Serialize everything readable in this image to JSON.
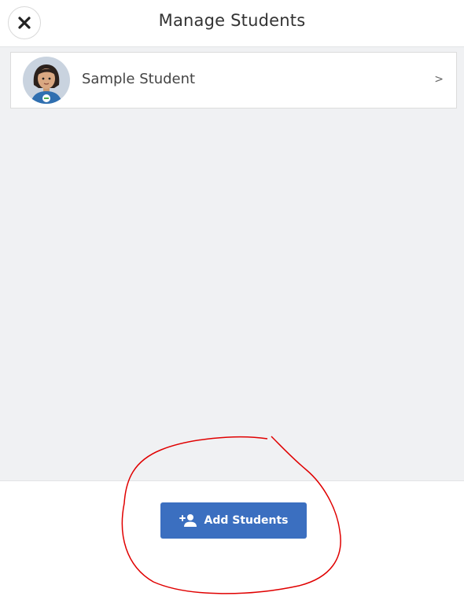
{
  "header": {
    "title": "Manage Students",
    "close_icon": "close-icon"
  },
  "students": [
    {
      "name": "Sample Student",
      "avatar_icon": "student-avatar",
      "chevron": ">"
    }
  ],
  "footer": {
    "add_label": "Add Students",
    "add_icon": "add-person-icon"
  },
  "colors": {
    "primary_button": "#3b6fc0",
    "content_background": "#f0f1f3",
    "annotation": "#e00000"
  }
}
